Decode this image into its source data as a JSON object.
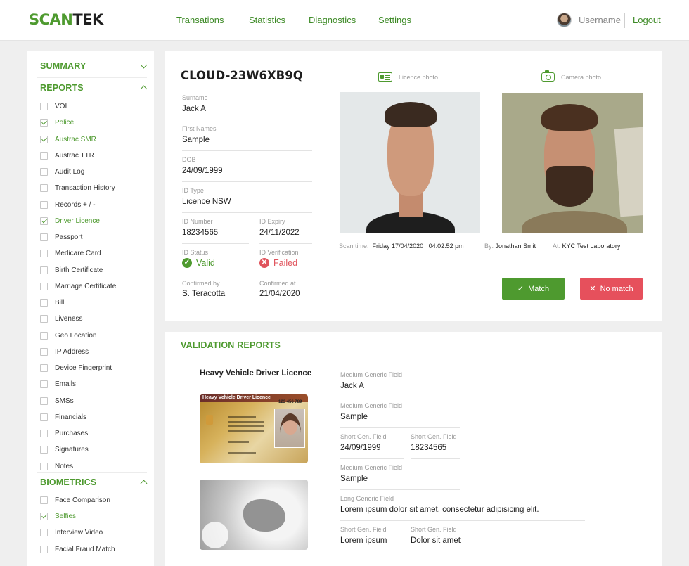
{
  "header": {
    "logo": "SCANTEK",
    "nav": [
      "Transations",
      "Statistics",
      "Diagnostics",
      "Settings"
    ],
    "username": "Username",
    "logout": "Logout"
  },
  "sidebar": {
    "summary": "SUMMARY",
    "reports": {
      "title": "REPORTS",
      "items": [
        {
          "label": "VOI",
          "checked": false
        },
        {
          "label": "Police",
          "checked": true
        },
        {
          "label": "Austrac SMR",
          "checked": true
        },
        {
          "label": "Austrac TTR",
          "checked": false
        },
        {
          "label": "Audit Log",
          "checked": false
        },
        {
          "label": "Transaction History",
          "checked": false
        },
        {
          "label": "Records + / -",
          "checked": false
        },
        {
          "label": "Driver Licence",
          "checked": true
        },
        {
          "label": "Passport",
          "checked": false
        },
        {
          "label": "Medicare Card",
          "checked": false
        },
        {
          "label": "Birth Certificate",
          "checked": false
        },
        {
          "label": "Marriage Certificate",
          "checked": false
        },
        {
          "label": "Bill",
          "checked": false
        },
        {
          "label": "Liveness",
          "checked": false
        },
        {
          "label": "Geo Location",
          "checked": false
        },
        {
          "label": "IP Address",
          "checked": false
        },
        {
          "label": "Device Fingerprint",
          "checked": false
        },
        {
          "label": "Emails",
          "checked": false
        },
        {
          "label": "SMSs",
          "checked": false
        },
        {
          "label": "Financials",
          "checked": false
        },
        {
          "label": "Purchases",
          "checked": false
        },
        {
          "label": "Signatures",
          "checked": false
        },
        {
          "label": "Notes",
          "checked": false
        }
      ]
    },
    "biometrics": {
      "title": "BIOMETRICS",
      "items": [
        {
          "label": "Face Comparison",
          "checked": false
        },
        {
          "label": "Selfies",
          "checked": true
        },
        {
          "label": "Interview Video",
          "checked": false
        },
        {
          "label": "Facial Fraud Match",
          "checked": false
        }
      ]
    }
  },
  "transaction": {
    "id": "CLOUD-23W6XB9Q",
    "fields": {
      "surname": {
        "label": "Surname",
        "value": "Jack A"
      },
      "first_names": {
        "label": "First Names",
        "value": "Sample"
      },
      "dob": {
        "label": "DOB",
        "value": "24/09/1999"
      },
      "id_type": {
        "label": "ID Type",
        "value": "Licence NSW"
      },
      "id_number": {
        "label": "ID Number",
        "value": "18234565"
      },
      "id_expiry": {
        "label": "ID Expiry",
        "value": "24/11/2022"
      },
      "id_status": {
        "label": "ID Status",
        "value": "Valid"
      },
      "id_verification": {
        "label": "ID Verification",
        "value": "Failed"
      },
      "confirmed_by": {
        "label": "Confirmed by",
        "value": "S. Teracotta"
      },
      "confirmed_at": {
        "label": "Confirmed at",
        "value": "21/04/2020"
      }
    },
    "licence_photo_label": "Licence photo",
    "camera_photo_label": "Camera photo",
    "scan": {
      "time_label": "Scan time:",
      "date": "Friday 17/04/2020",
      "time": "04:02:52 pm",
      "by_label": "By:",
      "by": "Jonathan Smit",
      "at_label": "At:",
      "at": "KYC Test Laboratory"
    },
    "match_label": "Match",
    "no_match_label": "No match"
  },
  "validation": {
    "title": "VALIDATION REPORTS",
    "doc_title": "Heavy Vehicle Driver Licence",
    "card_front": {
      "title": "Heavy Vehicle Driver Licence",
      "number": "123 456 789"
    },
    "fields": [
      {
        "label": "Medium Generic Field",
        "value": "Jack A"
      },
      {
        "label": "Medium Generic Field",
        "value": "Sample"
      },
      {
        "label": "Short Gen. Field",
        "value": "24/09/1999"
      },
      {
        "label": "Short  Gen. Field",
        "value": "18234565"
      },
      {
        "label": "Medium Generic Field",
        "value": "Sample"
      },
      {
        "label": "Long Generic Field",
        "value": "Lorem ipsum dolor sit amet, consectetur adipisicing elit."
      },
      {
        "label": "Short Gen. Field",
        "value": "Lorem ipsum"
      },
      {
        "label": "Short  Gen. Field",
        "value": "Dolor sit amet"
      }
    ]
  },
  "colors": {
    "accent": "#4e9a2f",
    "danger": "#e6505c"
  }
}
